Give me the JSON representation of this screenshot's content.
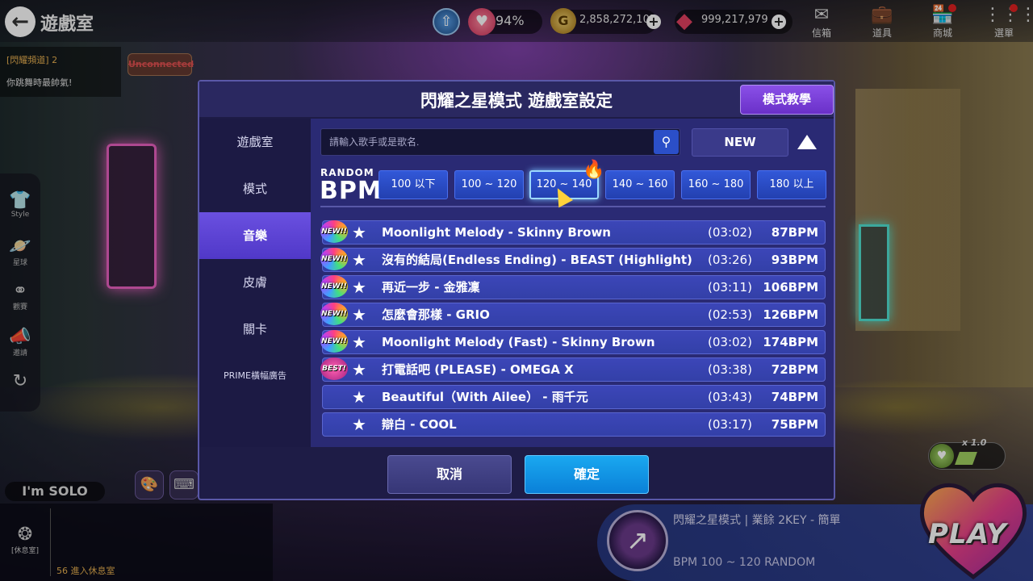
{
  "topbar": {
    "room_title": "遊戲室",
    "heart_pct": "94%",
    "coins": "2,858,272,105",
    "gems": "999,217,979",
    "menu": [
      {
        "label": "信箱",
        "icon": "mail-icon"
      },
      {
        "label": "道具",
        "icon": "bag-icon"
      },
      {
        "label": "商城",
        "icon": "shop-icon"
      },
      {
        "label": "選單",
        "icon": "grid-menu-icon"
      }
    ]
  },
  "chat": {
    "channel": "[閃耀頻道] 2",
    "message": "你跳舞時最帥氣!",
    "status": "Unconnected"
  },
  "side_rail": [
    {
      "label": "Style",
      "icon": "shirt-icon"
    },
    {
      "label": "星球",
      "icon": "planet-icon"
    },
    {
      "label": "觀賽",
      "icon": "binoculars-icon"
    },
    {
      "label": "邀請",
      "icon": "megaphone-icon"
    },
    {
      "label": "",
      "icon": "refresh-icon"
    }
  ],
  "solo_tag": "I'm SOLO",
  "lounge": {
    "label": "[休息室]",
    "text": "56 進入休息室"
  },
  "now_playing": {
    "title": "閃耀之星模式 | 業餘  2KEY - 簡單",
    "subtitle": "BPM 100 ~ 120 RANDOM",
    "play_label": "PLAY",
    "speed": "x 1.0"
  },
  "modal": {
    "title": "閃耀之星模式 遊戲室設定",
    "tutorial_label": "模式教學",
    "tabs": [
      {
        "label": "遊戲室",
        "active": false
      },
      {
        "label": "模式",
        "active": false
      },
      {
        "label": "音樂",
        "active": true
      },
      {
        "label": "皮膚",
        "active": false
      },
      {
        "label": "關卡",
        "active": false
      },
      {
        "label": "PRIME橫幅廣告",
        "active": false
      }
    ],
    "search_placeholder": "請輸入歌手或是歌名.",
    "new_label": "NEW",
    "bpm_small": "RANDOM",
    "bpm_big": "BPM",
    "bpm_ranges": [
      {
        "label": "100 以下",
        "selected": false
      },
      {
        "label": "100 ~ 120",
        "selected": false
      },
      {
        "label": "120 ~ 140",
        "selected": true
      },
      {
        "label": "140 ~ 160",
        "selected": false
      },
      {
        "label": "160 ~ 180",
        "selected": false
      },
      {
        "label": "180 以上",
        "selected": false
      }
    ],
    "songs": [
      {
        "tag": "NEW!!",
        "title": "Moonlight Melody - Skinny Brown",
        "duration": "(03:02)",
        "bpm": "87BPM"
      },
      {
        "tag": "NEW!!",
        "title": "沒有的結局(Endless Ending) - BEAST (Highlight)",
        "duration": "(03:26)",
        "bpm": "93BPM"
      },
      {
        "tag": "NEW!!",
        "title": "再近一步 - 金雅凜",
        "duration": "(03:11)",
        "bpm": "106BPM"
      },
      {
        "tag": "NEW!!",
        "title": "怎麼會那樣 - GRIO",
        "duration": "(02:53)",
        "bpm": "126BPM"
      },
      {
        "tag": "NEW!!",
        "title": "Moonlight Melody (Fast) - Skinny Brown",
        "duration": "(03:02)",
        "bpm": "174BPM"
      },
      {
        "tag": "BEST!",
        "title": "打電話吧 (PLEASE) - OMEGA X",
        "duration": "(03:38)",
        "bpm": "72BPM"
      },
      {
        "tag": "",
        "title": "Beautiful（With Ailee） - 雨千元",
        "duration": "(03:43)",
        "bpm": "74BPM"
      },
      {
        "tag": "",
        "title": "辯白 - COOL",
        "duration": "(03:17)",
        "bpm": "75BPM"
      }
    ],
    "cancel_label": "取消",
    "confirm_label": "確定"
  }
}
